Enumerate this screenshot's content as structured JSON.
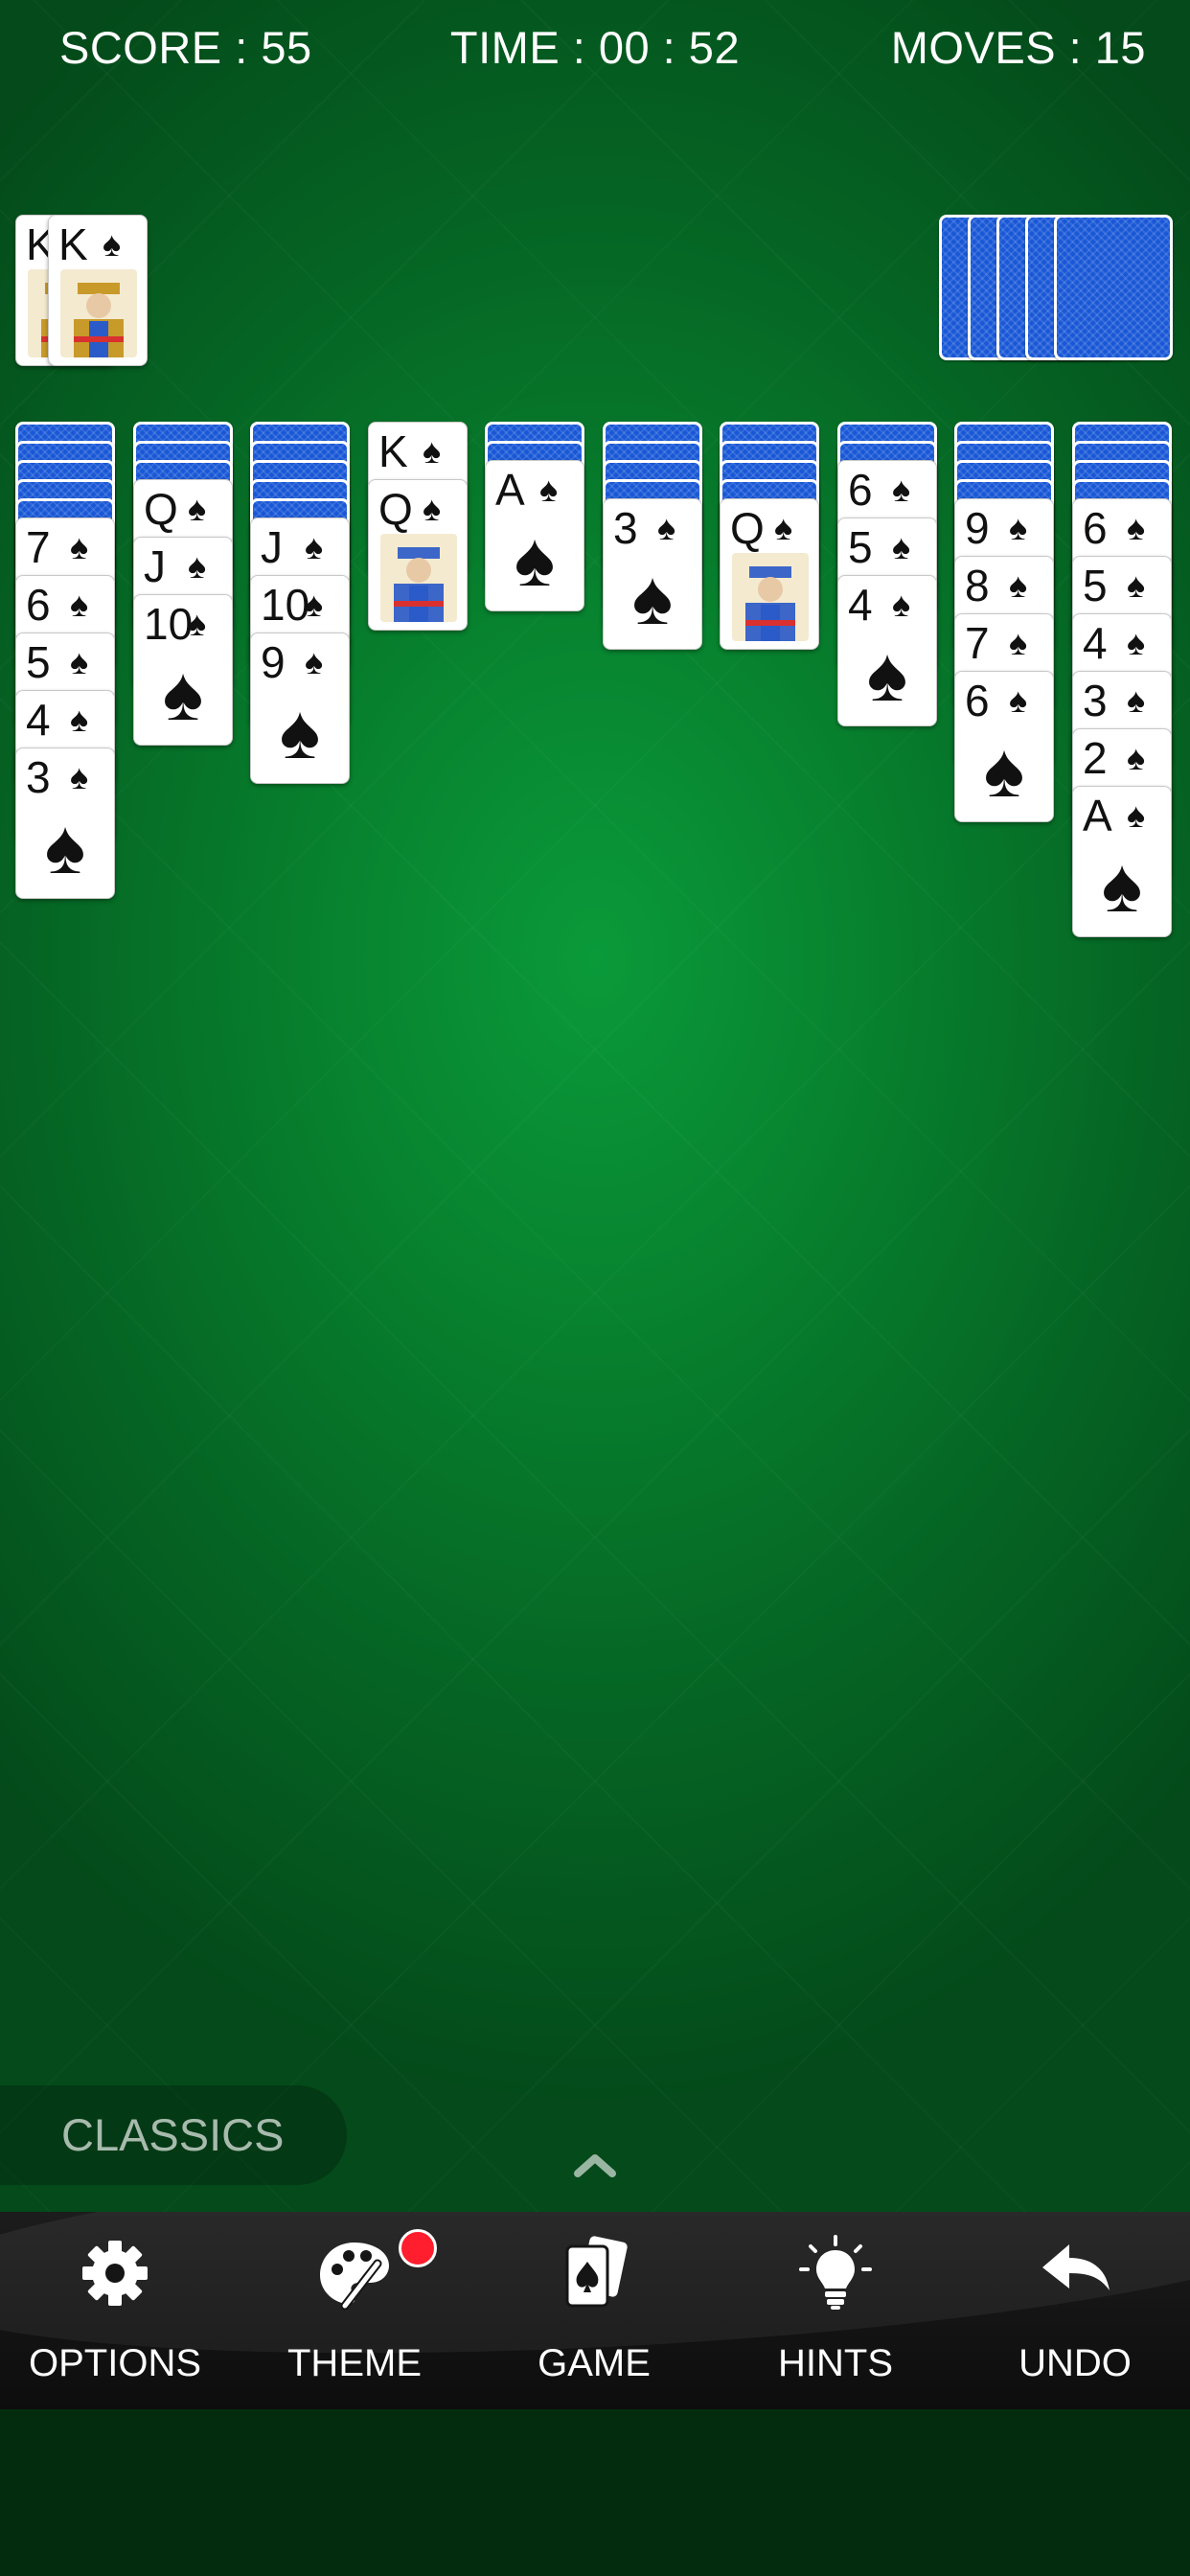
{
  "hud": {
    "score": "SCORE : 55",
    "time": "TIME : 00 : 52",
    "moves": "MOVES : 15"
  },
  "foundation": {
    "completed_sets": [
      {
        "rank": "K",
        "suit": "♠"
      },
      {
        "rank": "K",
        "suit": "♠"
      }
    ]
  },
  "stock": {
    "remaining_deals": 5
  },
  "tableau": [
    {
      "face_down": 5,
      "cards": [
        "7",
        "6",
        "5",
        "4",
        "3"
      ]
    },
    {
      "face_down": 3,
      "cards": [
        "Q",
        "J",
        "10"
      ]
    },
    {
      "face_down": 5,
      "cards": [
        "J",
        "10",
        "9"
      ]
    },
    {
      "face_down": 0,
      "cards": [
        "K",
        "Q"
      ]
    },
    {
      "face_down": 2,
      "cards": [
        "A"
      ]
    },
    {
      "face_down": 4,
      "cards": [
        "3"
      ]
    },
    {
      "face_down": 4,
      "cards": [
        "Q"
      ]
    },
    {
      "face_down": 2,
      "cards": [
        "6",
        "5",
        "4"
      ]
    },
    {
      "face_down": 4,
      "cards": [
        "9",
        "8",
        "7",
        "6"
      ]
    },
    {
      "face_down": 4,
      "cards": [
        "6",
        "5",
        "4",
        "3",
        "2",
        "A"
      ]
    }
  ],
  "suit": "♠",
  "mode_label": "CLASSICS",
  "toolbar": {
    "options": "OPTIONS",
    "theme": "THEME",
    "game": "GAME",
    "hints": "HINTS",
    "undo": "UNDO"
  },
  "colors": {
    "felt": "#077f2d",
    "card_back": "#1857d6",
    "badge": "#ff1e2d"
  }
}
